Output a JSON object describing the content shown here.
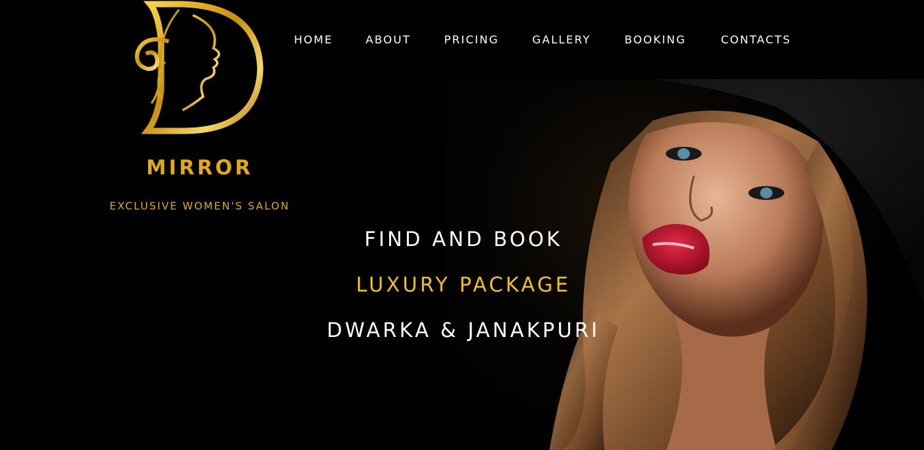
{
  "brand": {
    "name": "MIRROR",
    "tagline": "EXCLUSIVE WOMEN'S SALON",
    "accent_color": "#e1a915"
  },
  "nav": {
    "items": [
      {
        "label": "HOME"
      },
      {
        "label": "ABOUT"
      },
      {
        "label": "PRICING"
      },
      {
        "label": "GALLERY"
      },
      {
        "label": "BOOKING"
      },
      {
        "label": "CONTACTS"
      }
    ]
  },
  "hero": {
    "line1": "FIND AND BOOK",
    "line2": "LUXURY PACKAGE",
    "line3": "DWARKA & JANAKPURI",
    "highlight_color": "#f1c21b",
    "image": "woman-portrait"
  }
}
